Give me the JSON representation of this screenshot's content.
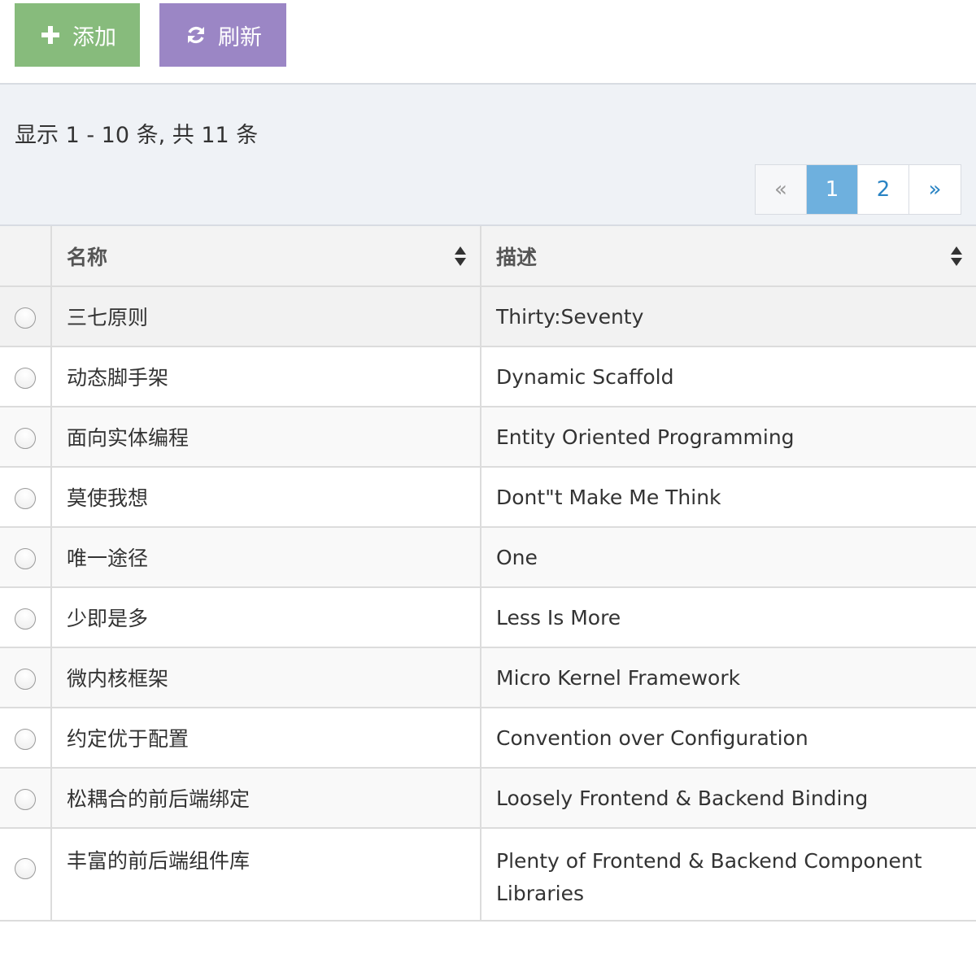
{
  "toolbar": {
    "add_label": "添加",
    "refresh_label": "刷新",
    "add_icon": "plus-icon",
    "refresh_icon": "refresh-icon",
    "add_color": "#87bb7c",
    "refresh_color": "#9b86c5"
  },
  "pagination": {
    "summary": "显示 1 - 10 条, 共 11 条",
    "prev": "«",
    "pages": [
      "1",
      "2"
    ],
    "active_page": "1",
    "next": "»"
  },
  "table": {
    "columns": [
      "名称",
      "描述"
    ],
    "rows": [
      {
        "name": "三七原则",
        "desc": "Thirty:Seventy"
      },
      {
        "name": "动态脚手架",
        "desc": "Dynamic Scaffold"
      },
      {
        "name": "面向实体编程",
        "desc": "Entity Oriented Programming"
      },
      {
        "name": "莫使我想",
        "desc": "Dont\"t Make Me Think"
      },
      {
        "name": "唯一途径",
        "desc": "One"
      },
      {
        "name": "少即是多",
        "desc": "Less Is More"
      },
      {
        "name": "微内核框架",
        "desc": "Micro Kernel Framework"
      },
      {
        "name": "约定优于配置",
        "desc": "Convention over Configuration"
      },
      {
        "name": "松耦合的前后端绑定",
        "desc": "Loosely Frontend & Backend Binding"
      },
      {
        "name": "丰富的前后端组件库",
        "desc": "Plenty of Frontend & Backend Component Libraries"
      }
    ]
  }
}
